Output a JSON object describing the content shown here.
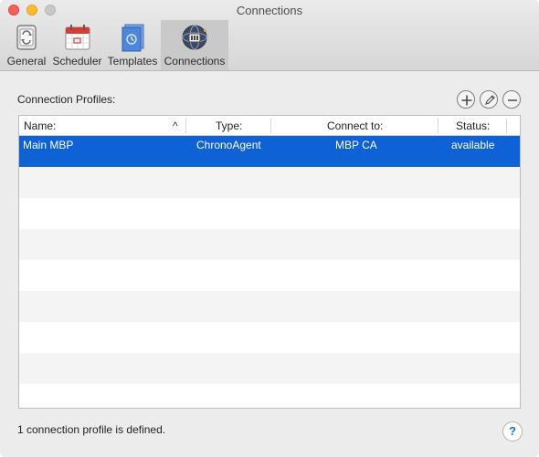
{
  "window": {
    "title": "Connections"
  },
  "toolbar": {
    "tabs": [
      {
        "label": "General",
        "icon": "general-switch-icon"
      },
      {
        "label": "Scheduler",
        "icon": "calendar-icon"
      },
      {
        "label": "Templates",
        "icon": "templates-document-icon"
      },
      {
        "label": "Connections",
        "icon": "connections-globe-icon",
        "selected": true
      }
    ]
  },
  "profiles": {
    "section_label": "Connection Profiles:",
    "add_icon": "plus-icon",
    "edit_icon": "pencil-icon",
    "remove_icon": "minus-icon",
    "columns": [
      "Name:",
      "Type:",
      "Connect to:",
      "Status:"
    ],
    "sort_indicator": "^",
    "rows": [
      {
        "name": "Main MBP",
        "type": "ChronoAgent",
        "connect_to": "MBP CA",
        "status": "available"
      }
    ]
  },
  "footer": {
    "status_text": "1 connection profile is defined.",
    "help_label": "?"
  },
  "colors": {
    "selection": "#0f62d6",
    "alt_row": "#f4f4f4",
    "help_accent": "#1b68e0"
  }
}
